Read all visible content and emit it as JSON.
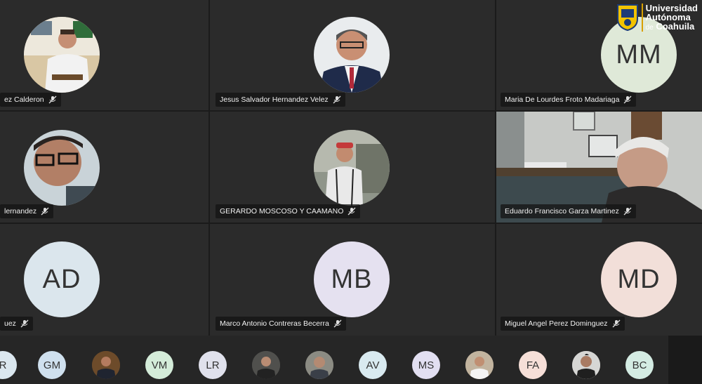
{
  "branding": {
    "line1": "Universidad",
    "line2": "Autónoma",
    "line3_prefix": "de",
    "line3": "Coahuila"
  },
  "tiles": [
    {
      "name": "ez Calderon",
      "initials": ""
    },
    {
      "name": "Jesus Salvador Hernandez Velez",
      "initials": ""
    },
    {
      "name": "Maria De Lourdes Froto Madariaga",
      "initials": "MM"
    },
    {
      "name": "lernandez",
      "initials": ""
    },
    {
      "name": "GERARDO MOSCOSO Y CAAMANO",
      "initials": ""
    },
    {
      "name": "Eduardo Francisco Garza Martinez",
      "initials": ""
    },
    {
      "name": "uez",
      "initials": "AD"
    },
    {
      "name": "Marco Antonio Contreras Becerra",
      "initials": "MB"
    },
    {
      "name": "Miguel Angel Perez Dominguez",
      "initials": "MD"
    }
  ],
  "strip": [
    {
      "initials": "R",
      "color": "#dbe7ef"
    },
    {
      "initials": "GM",
      "color": "#cfe0ee"
    },
    {
      "initials": "",
      "color": "#6d4b2a"
    },
    {
      "initials": "VM",
      "color": "#d4ecd9"
    },
    {
      "initials": "LR",
      "color": "#e0e1ec"
    },
    {
      "initials": "",
      "color": "#50504d"
    },
    {
      "initials": "",
      "color": "#8b8b83"
    },
    {
      "initials": "AV",
      "color": "#d9eaf0"
    },
    {
      "initials": "MS",
      "color": "#e2dff1"
    },
    {
      "initials": "",
      "color": "#c2b49f"
    },
    {
      "initials": "FA",
      "color": "#f6dfd8"
    },
    {
      "initials": "",
      "color": "#d6d6d4"
    },
    {
      "initials": "BC",
      "color": "#d4ece3"
    }
  ],
  "colors": {
    "mm": "#dfe9d8",
    "ad": "#dbe6ed",
    "mb": "#e5e1f0",
    "md": "#f2dfd9"
  }
}
